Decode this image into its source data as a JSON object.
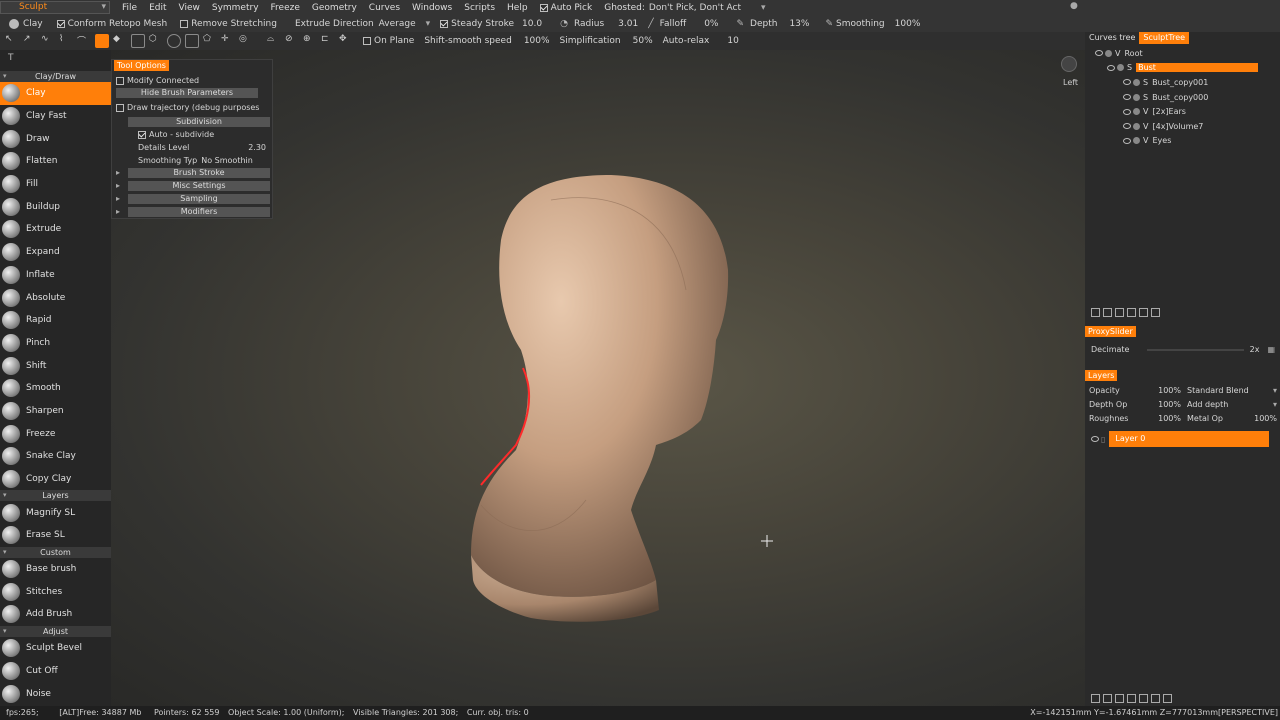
{
  "top": {
    "mode": "Sculpt",
    "menus": [
      "File",
      "Edit",
      "View",
      "Symmetry",
      "Freeze",
      "Geometry",
      "Curves",
      "Windows",
      "Scripts",
      "Help"
    ],
    "auto_pick": "Auto Pick",
    "ghosted_label": "Ghosted:",
    "ghosted_value": "Don't Pick, Don't Act",
    "tool_name": "Clay",
    "conform": "Conform Retopo Mesh",
    "remove_stretching": "Remove Stretching",
    "extrude_direction": "Extrude Direction",
    "extrude_value": "Average",
    "steady_stroke": "Steady Stroke",
    "steady_value": "10.0",
    "radius": "Radius",
    "radius_value": "3.01",
    "falloff": "Falloff",
    "falloff_value": "0%",
    "depth": "Depth",
    "depth_value": "13%",
    "smoothing": "Smoothing",
    "smoothing_value": "100%"
  },
  "toolrow": {
    "on_plane": "On Plane",
    "shift_smooth": "Shift-smooth speed",
    "shift_smooth_value": "100%",
    "simplification": "Simplification",
    "simplification_value": "50%",
    "auto_relax": "Auto-relax",
    "auto_relax_value": "10"
  },
  "left": {
    "section1": "Clay/Draw",
    "tools1": [
      "Clay",
      "Clay Fast",
      "Draw",
      "Flatten",
      "Fill",
      "Buildup",
      "Extrude",
      "Expand",
      "Inflate",
      "Absolute",
      "Rapid",
      "Pinch",
      "Shift",
      "Smooth",
      "Sharpen",
      "Freeze",
      "Snake Clay",
      "Copy Clay"
    ],
    "section2": "Layers",
    "tools2": [
      "Magnify SL",
      "Erase SL"
    ],
    "section3": "Custom",
    "tools3": [
      "Base brush",
      "Stitches",
      "Add Brush"
    ],
    "section4": "Adjust",
    "tools4": [
      "Sculpt Bevel",
      "Cut Off",
      "Noise"
    ]
  },
  "options": {
    "tab": "Tool Options",
    "modify_connected": "Modify Connected",
    "hide_brush": "Hide Brush Parameters",
    "draw_trajectory": "Draw trajectory (debug purposes",
    "subdivision": "Subdivision",
    "auto_subdivide": "Auto - subdivide",
    "details_level": "Details Level",
    "details_value": "2.30",
    "smoothing_typ": "Smoothing Typ",
    "smoothing_typ_value": "No Smoothin",
    "brush_stroke": "Brush Stroke",
    "misc_settings": "Misc Settings",
    "sampling": "Sampling",
    "modifiers": "Modifiers"
  },
  "viewport": {
    "view_label": "Left"
  },
  "right": {
    "tabs": [
      "Curves tree",
      "SculptTree"
    ],
    "tree": [
      {
        "type": "V",
        "name": "Root"
      },
      {
        "type": "S",
        "name": "Bust"
      },
      {
        "type": "S",
        "name": "Bust_copy001"
      },
      {
        "type": "S",
        "name": "Bust_copy000"
      },
      {
        "type": "V",
        "name": "[2x]Ears"
      },
      {
        "type": "V",
        "name": "[4x]Volume7"
      },
      {
        "type": "V",
        "name": "Eyes"
      }
    ],
    "proxy_header": "ProxySlider",
    "decimate": "Decimate",
    "decimate_value": "2x",
    "layers_header": "Layers",
    "opacity": "Opacity",
    "opacity_value": "100%",
    "blend": "Standard Blend",
    "depth_op": "Depth Op",
    "depth_op_value": "100%",
    "add_depth": "Add depth",
    "roughness": "Roughnes",
    "roughness_value": "100%",
    "metal": "Metal Op",
    "metal_value": "100%",
    "layer_name": "Layer 0"
  },
  "status": {
    "fps": "fps:265;",
    "alt": "[ALT]Free: 34887 Mb",
    "pointers": "Pointers: 62 559",
    "scale": "Object Scale: 1.00 (Uniform);",
    "visible": "Visible Triangles: 201 308;",
    "curr": "Curr. obj. tris: 0",
    "coords": "X=-142151mm  Y=-1.67461mm  Z=777013mm[PERSPECTIVE]"
  },
  "colors": {
    "accent": "#ff7f0a"
  }
}
